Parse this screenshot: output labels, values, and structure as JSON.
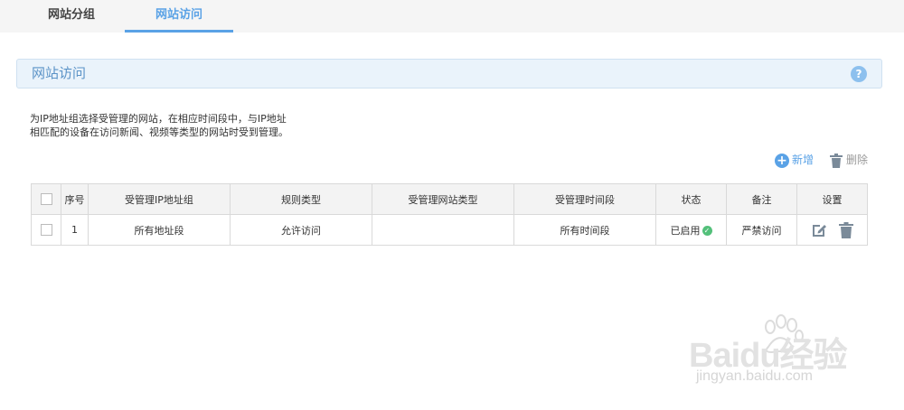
{
  "tabs": [
    {
      "label": "网站分组",
      "active": false
    },
    {
      "label": "网站访问",
      "active": true
    }
  ],
  "section": {
    "title": "网站访问",
    "help_icon": "?"
  },
  "description": {
    "line1": "为IP地址组选择受管理的网站，在相应时间段中，与IP地址",
    "line2": "相匹配的设备在访问新闻、视频等类型的网站时受到管理。"
  },
  "actions": {
    "add_label": "新增",
    "delete_label": "删除"
  },
  "table": {
    "headers": [
      "",
      "序号",
      "受管理IP地址组",
      "规则类型",
      "受管理网站类型",
      "受管理时间段",
      "状态",
      "备注",
      "设置"
    ],
    "rows": [
      {
        "index": "1",
        "ip_group": "所有地址段",
        "rule_type": "允许访问",
        "site_type": "",
        "time_period": "所有时间段",
        "status": "已启用",
        "note": "严禁访问"
      }
    ]
  },
  "watermark": {
    "brand": "Baidu经验",
    "url": "jingyan.baidu.com"
  },
  "colors": {
    "accent": "#5aa2e6",
    "section_bg": "#eaf3fb",
    "status_ok": "#53c07a"
  }
}
